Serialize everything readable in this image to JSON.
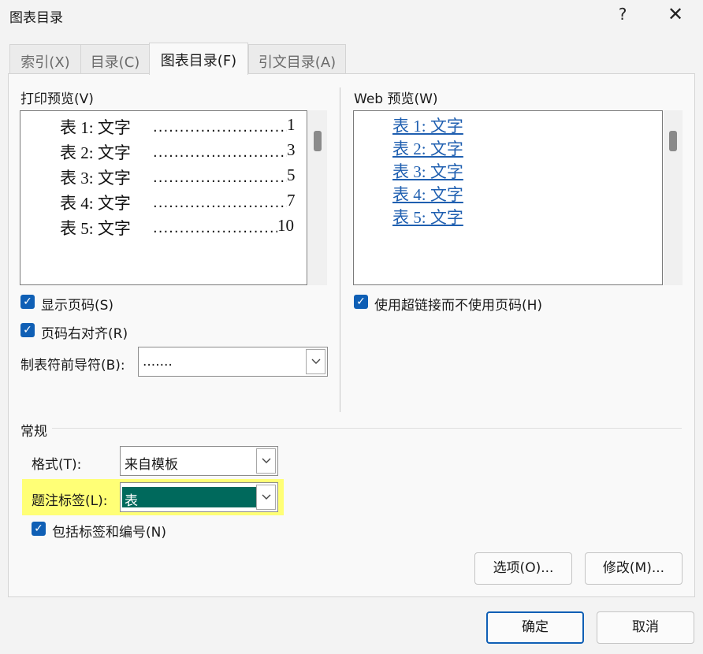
{
  "dialog": {
    "title": "图表目录",
    "help": "?",
    "close": "✕"
  },
  "tabs": [
    {
      "label": "索引(X)",
      "active": false
    },
    {
      "label": "目录(C)",
      "active": false
    },
    {
      "label": "图表目录(F)",
      "active": true
    },
    {
      "label": "引文目录(A)",
      "active": false
    }
  ],
  "print_preview": {
    "label": "打印预览(V)",
    "entries": [
      {
        "label": "表",
        "num": "1:",
        "text": "文字",
        "page": "1"
      },
      {
        "label": "表",
        "num": "2:",
        "text": "文字",
        "page": "3"
      },
      {
        "label": "表",
        "num": "3:",
        "text": "文字",
        "page": "5"
      },
      {
        "label": "表",
        "num": "4:",
        "text": "文字",
        "page": "7"
      },
      {
        "label": "表",
        "num": "5:",
        "text": "文字",
        "page": "10"
      }
    ]
  },
  "web_preview": {
    "label": "Web 预览(W)",
    "entries": [
      "表 1: 文字",
      "表 2: 文字",
      "表 3: 文字",
      "表 4: 文字",
      "表 5: 文字"
    ]
  },
  "options": {
    "show_page_numbers": {
      "label": "显示页码(S)",
      "checked": true
    },
    "right_align": {
      "label": "页码右对齐(R)",
      "checked": true
    },
    "tab_leader": {
      "label": "制表符前导符(B):",
      "value": "......."
    },
    "use_hyperlinks": {
      "label": "使用超链接而不使用页码(H)",
      "checked": true
    }
  },
  "general": {
    "heading": "常规",
    "format": {
      "label": "格式(T):",
      "value": "来自模板"
    },
    "caption_label": {
      "label": "题注标签(L):",
      "value": "表"
    },
    "include_label": {
      "label": "包括标签和编号(N)",
      "checked": true
    }
  },
  "buttons": {
    "options": "选项(O)...",
    "modify": "修改(M)...",
    "ok": "确定",
    "cancel": "取消"
  },
  "colors": {
    "accent": "#0f5fb5",
    "link": "#1f5fb0",
    "selection": "#00695c",
    "highlight": "#ffff76"
  }
}
